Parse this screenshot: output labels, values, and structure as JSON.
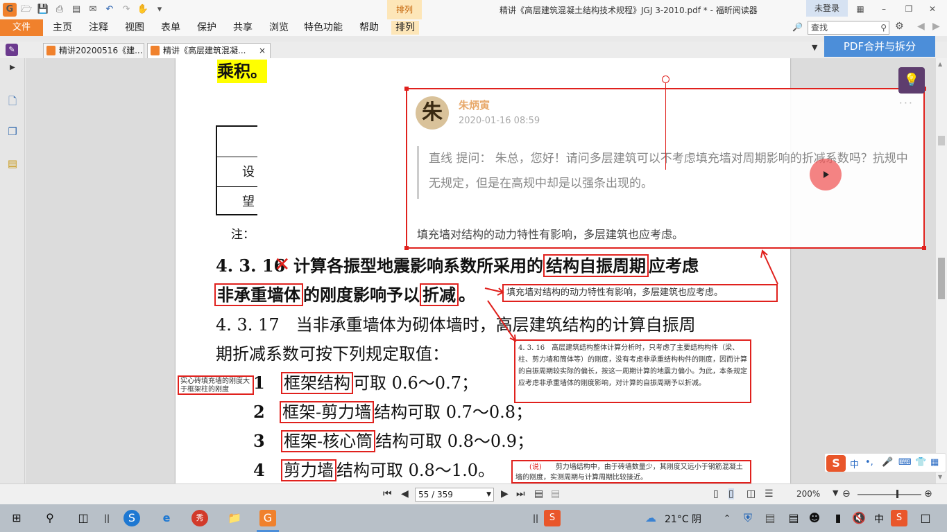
{
  "titlebar": {
    "context_tab": "排列",
    "window_title": "精讲《高层建筑混凝土结构技术规程》JGJ 3-2010.pdf * - 福昕阅读器",
    "login": "未登录"
  },
  "menu": {
    "file": "文件",
    "items": [
      "主页",
      "注释",
      "视图",
      "表单",
      "保护",
      "共享",
      "浏览",
      "特色功能",
      "帮助",
      "排列"
    ]
  },
  "search": {
    "placeholder": "查找"
  },
  "tabs": [
    {
      "label": "精讲20200516《建..."
    },
    {
      "label": "精讲《高层建筑混凝...",
      "close": "×"
    }
  ],
  "pdf_merge": "PDF合并与拆分",
  "page": {
    "top_fragment": "乘积。",
    "table_cells": [
      "设",
      "望"
    ],
    "note_prefix": "注：",
    "clause_16_num": "4. 3. 16",
    "clause_16_a": "计算各振型地震影响系数所采用的",
    "clause_16_box1": "结构自振周期",
    "clause_16_b": "应考虑",
    "clause_16_box2": "非承重墙体",
    "clause_16_c": "的刚度影响予以",
    "clause_16_box3": "折减",
    "clause_16_d": "。",
    "clause_17_line1": "4. 3. 17　当非承重墙体为砌体墙时，高层建筑结构的计算自振周",
    "clause_17_line2": "期折减系数可按下列规定取值：",
    "items": [
      {
        "num": "1",
        "boxed": "框架结构",
        "rest": "可取 0.6～0.7；"
      },
      {
        "num": "2",
        "boxed": "框架-剪力墙",
        "rest": "结构可取 0.7～0.8；"
      },
      {
        "num": "3",
        "boxed": "框架-核心筒",
        "rest": "结构可取 0.8～0.9；"
      },
      {
        "num": "4",
        "boxed": "剪力墙",
        "rest": "结构可取 0.8～1.0。"
      }
    ],
    "side_note_left": "实心砖填充墙的刚度大于框架柱的刚度",
    "callout_right": "填充墙对结构的动力特性有影响，多层建筑也应考虑。",
    "commentary_note": "4. 3. 16　高层建筑结构整体计算分析时，只考虑了主要结构构件（梁、柱、剪力墙和筒体等）的刚度，没有考虑非承重结构构件的刚度，因而计算的自振周期较实际的偏长，按这一周期计算的地震力偏小。为此，本条规定应考虑非承重墙体的刚度影响，对计算的自振周期予以折减。",
    "commentary_note2_label": "(说)",
    "commentary_note2": "剪力墙结构中，由于砖墙数量少，其刚度又远小于钢筋混凝土墙的刚度，实测周期与计算周期比较接近。"
  },
  "comment_popup": {
    "author": "朱炳寅",
    "avatar_char": "朱",
    "date": "2020-01-16 08:59",
    "more": "···",
    "question": "直线  提问：  朱总，您好！请问多层建筑可以不考虑填充墙对周期影响的折减系数吗？抗规中无规定，但是在高规中却是以强条出现的。",
    "reply": "填充墙对结构的动力特性有影响，多层建筑也应考虑。"
  },
  "statusbar": {
    "page_indicator": "55 / 359",
    "zoom": "200%"
  },
  "ime": {
    "lang": "中",
    "punct": "•,"
  },
  "taskbar": {
    "weather": "21°C  阴",
    "ime_lang": "中"
  },
  "colors": {
    "accent_orange": "#f0812c",
    "annotation_red": "#e0211d",
    "highlight_yellow": "#ffff00",
    "merge_blue": "#4c8ed9"
  }
}
